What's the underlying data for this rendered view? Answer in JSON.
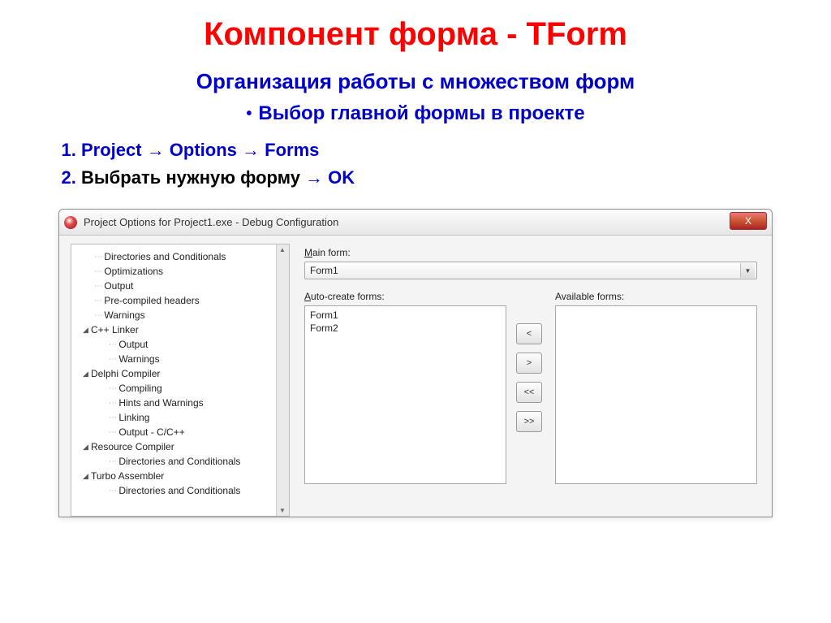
{
  "slide": {
    "title": "Компонент форма - TForm",
    "subtitle": "Организация работы с множеством форм",
    "bullet": "Выбор главной формы в проекте",
    "step1_prefix": "Project → Options → Forms",
    "step2_prefix": "Выбрать нужную форму",
    "step2_suffix": " → OK"
  },
  "window": {
    "title": "Project Options for Project1.exe - Debug Configuration",
    "close": "X"
  },
  "tree": {
    "n0": "Directories and Conditionals",
    "n1": "Optimizations",
    "n2": "Output",
    "n3": "Pre-compiled headers",
    "n4": "Warnings",
    "g1": "C++ Linker",
    "g1a": "Output",
    "g1b": "Warnings",
    "g2": "Delphi Compiler",
    "g2a": "Compiling",
    "g2b": "Hints and Warnings",
    "g2c": "Linking",
    "g2d": "Output - C/C++",
    "g3": "Resource Compiler",
    "g3a": "Directories and Conditionals",
    "g4": "Turbo Assembler",
    "g4a": "Directories and Conditionals"
  },
  "form": {
    "mainform_label_u": "M",
    "mainform_label_rest": "ain form:",
    "mainform_value": "Form1",
    "autocreate_label_u": "A",
    "autocreate_label_rest": "uto-create forms:",
    "available_label": "Available forms:",
    "auto_items": {
      "0": "Form1",
      "1": "Form2"
    }
  },
  "buttons": {
    "lt": "<",
    "gt": ">",
    "ltlt": "<<",
    "gtgt": ">>"
  }
}
